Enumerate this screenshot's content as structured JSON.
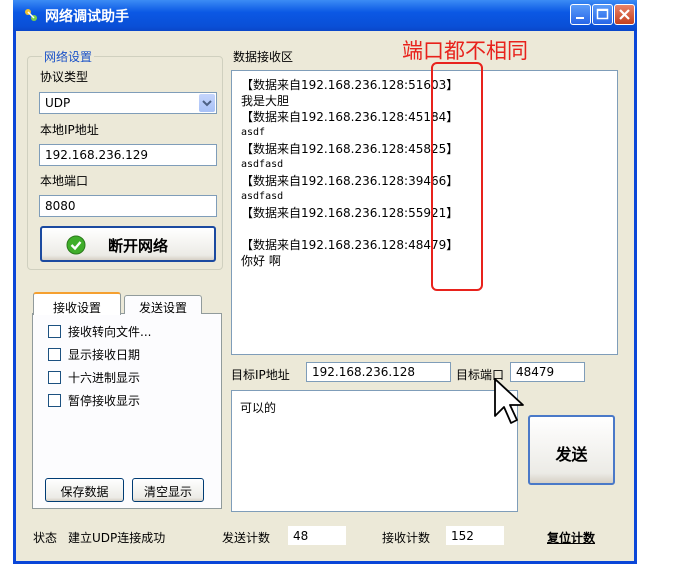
{
  "window": {
    "title": "网络调试助手"
  },
  "annotation": {
    "text": "端口都不相同",
    "color": "#e8221c"
  },
  "network": {
    "group_title": "网络设置",
    "protocol_label": "协议类型",
    "protocol_value": "UDP",
    "local_ip_label": "本地IP地址",
    "local_ip_value": "192.168.236.129",
    "local_port_label": "本地端口",
    "local_port_value": "8080",
    "connect_button": "断开网络"
  },
  "receive_area": {
    "title": "数据接收区",
    "log": [
      {
        "header": "【数据来自192.168.236.128:51603】",
        "body": "我是大胆"
      },
      {
        "header": "【数据来自192.168.236.128:45184】",
        "body": "asdf"
      },
      {
        "header": "【数据来自192.168.236.128:45825】",
        "body": "asdfasd"
      },
      {
        "header": "【数据来自192.168.236.128:39466】",
        "body": "asdfasd"
      },
      {
        "header": "【数据来自192.168.236.128:55921】",
        "body": ""
      },
      {
        "header": "【数据来自192.168.236.128:48479】",
        "body": "你好 啊"
      }
    ]
  },
  "tabs": {
    "receive": "接收设置",
    "send": "发送设置"
  },
  "receive_settings": {
    "options": [
      "接收转向文件...",
      "显示接收日期",
      "十六进制显示",
      "暂停接收显示"
    ],
    "save_button": "保存数据",
    "clear_button": "清空显示"
  },
  "target": {
    "ip_label": "目标IP地址",
    "ip_value": "192.168.236.128",
    "port_label": "目标端口",
    "port_value": "48479"
  },
  "send_area": {
    "text": "可以的",
    "send_button": "发送"
  },
  "status": {
    "state_label": "状态",
    "state_value": "建立UDP连接成功",
    "send_count_label": "发送计数",
    "send_count_value": "48",
    "recv_count_label": "接收计数",
    "recv_count_value": "152",
    "reset_label": "复位计数"
  }
}
